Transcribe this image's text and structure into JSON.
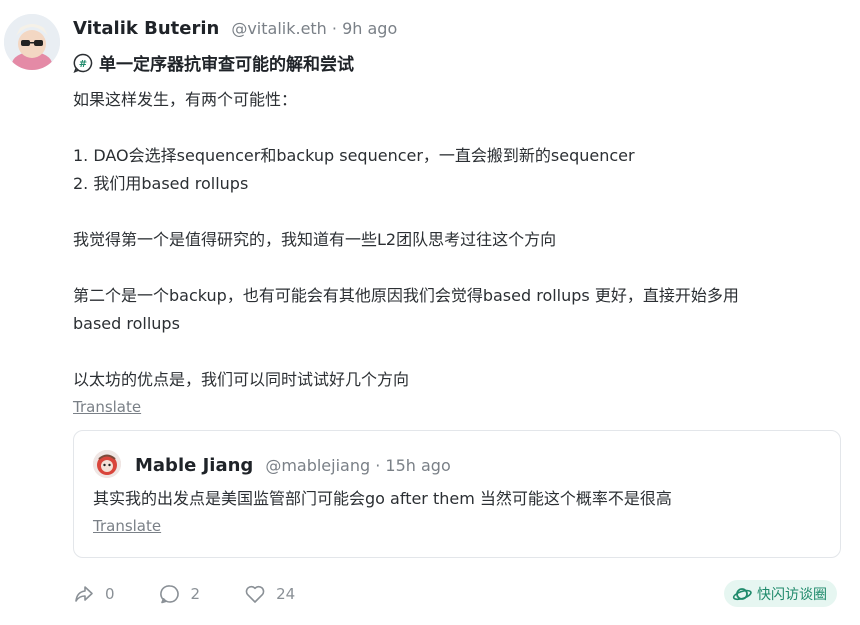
{
  "post": {
    "author_name": "Vitalik Buterin",
    "author_meta": "@vitalik.eth · 9h ago",
    "channel": {
      "icon": "hashtag-bubble-icon",
      "name": "单一定序器抗审查可能的解和尝试"
    },
    "body": "如果这样发生，有两个可能性：\n\n1. DAO会选择sequencer和backup sequencer，一直会搬到新的sequencer\n2. 我们用based rollups\n\n我觉得第一个是值得研究的，我知道有一些L2团队思考过往这个方向\n\n第二个是一个backup，也有可能会有其他原因我们会觉得based rollups 更好，直接开始多用\nbased rollups\n\n以太坊的优点是，我们可以同时试试好几个方向",
    "translate_label": "Translate"
  },
  "quote": {
    "author_name": "Mable Jiang",
    "author_meta": "@mablejiang · 15h ago",
    "text": "其实我的出发点是美国监管部门可能会go after them 当然可能这个概率不是很高",
    "translate_label": "Translate"
  },
  "actions": {
    "recast": {
      "icon": "share-arrow-icon",
      "count": "0"
    },
    "reply": {
      "icon": "comment-bubble-icon",
      "count": "2"
    },
    "like": {
      "icon": "heart-icon",
      "count": "24"
    }
  },
  "channel_chip": {
    "icon": "planet-icon",
    "label": "快闪访谈圈",
    "color": "#1f8a6b",
    "background": "#e6f6f1"
  }
}
